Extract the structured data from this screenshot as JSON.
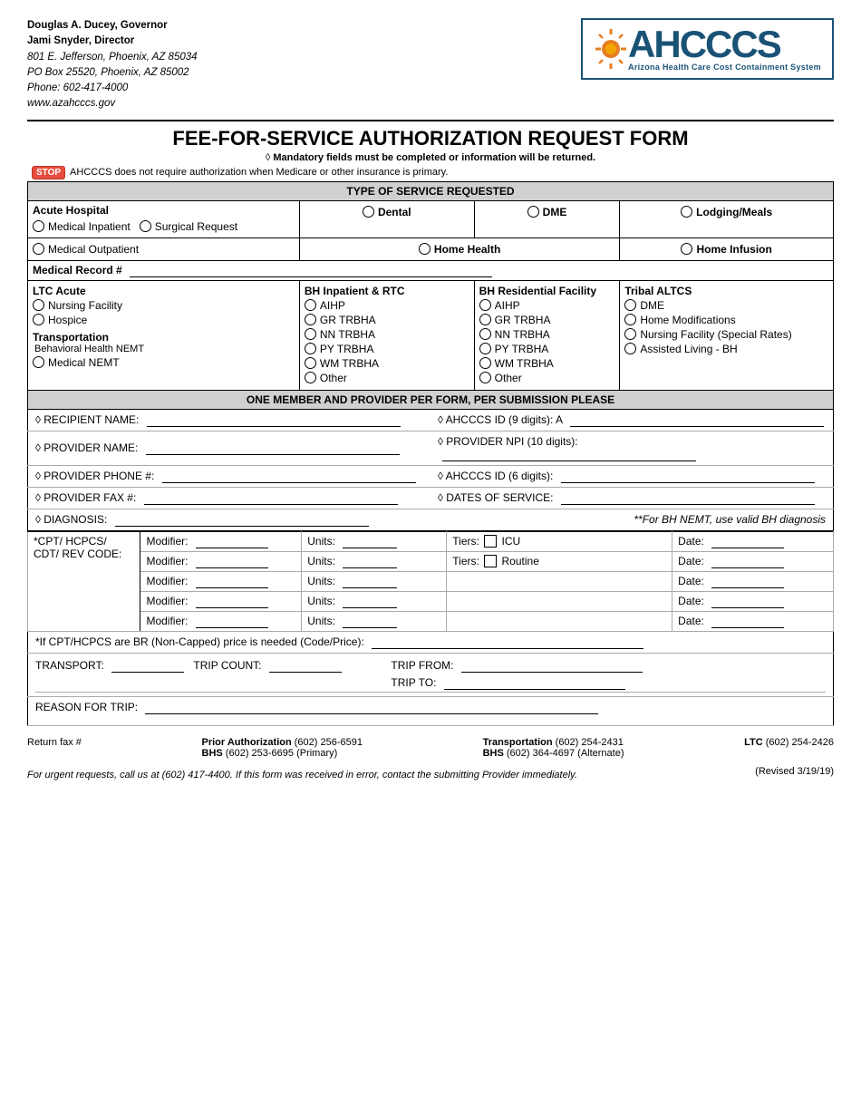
{
  "header": {
    "governor": "Douglas A. Ducey, Governor",
    "director": "Jami Snyder, Director",
    "address1": "801 E. Jefferson, Phoenix, AZ 85034",
    "address2": "PO Box 25520, Phoenix, AZ 85002",
    "phone": "Phone: 602-417-4000",
    "website": "www.azahcccs.gov",
    "org_name": "AHCCCS",
    "org_full": "Arizona Health Care Cost Containment System"
  },
  "form_title": "FEE-FOR-SERVICE AUTHORIZATION REQUEST FORM",
  "mandatory_note": "Mandatory fields must be completed or information will be returned.",
  "stop_note": "AHCCCS does not require authorization when Medicare or other insurance is primary.",
  "type_of_service": "TYPE OF SERVICE REQUESTED",
  "service_types": {
    "acute_hospital": "Acute Hospital",
    "medical_inpatient": "Medical Inpatient",
    "surgical_request": "Surgical Request",
    "dental": "Dental",
    "dme": "DME",
    "lodging_meals": "Lodging/Meals",
    "medical_outpatient": "Medical Outpatient",
    "home_health": "Home Health",
    "home_infusion": "Home Infusion"
  },
  "medical_record": "Medical Record #",
  "ltc_section": {
    "title": "LTC Acute",
    "nursing_facility": "Nursing Facility",
    "hospice": "Hospice",
    "transportation": "Transportation",
    "behavioral_health_nemt": "Behavioral Health NEMT",
    "medical_nemt": "Medical NEMT"
  },
  "bh_inpatient": {
    "title": "BH Inpatient & RTC",
    "aihp": "AIHP",
    "gr_trbha": "GR TRBHA",
    "nn_trbha": "NN TRBHA",
    "py_trbha": "PY TRBHA",
    "wm_trbha": "WM TRBHA",
    "other": "Other"
  },
  "bh_residential": {
    "title": "BH Residential Facility",
    "aihp": "AIHP",
    "gr_trbha": "GR TRBHA",
    "nn_trbha": "NN TRBHA",
    "py_trbha": "PY TRBHA",
    "wm_trbha": "WM TRBHA",
    "other": "Other"
  },
  "tribal_altcs": {
    "title": "Tribal ALTCS",
    "dme": "DME",
    "home_modifications": "Home Modifications",
    "nursing_facility_special": "Nursing Facility (Special Rates)",
    "assisted_living_bh": "Assisted Living - BH"
  },
  "one_member_note": "ONE MEMBER AND PROVIDER PER FORM, PER SUBMISSION PLEASE",
  "fields": {
    "recipient_name_label": "◊ RECIPIENT NAME:",
    "ahcccs_id_label": "◊ AHCCCS ID (9 digits): A",
    "provider_name_label": "◊ PROVIDER NAME:",
    "provider_npi_label": "◊ PROVIDER NPI (10 digits):",
    "provider_phone_label": "◊ PROVIDER PHONE #:",
    "ahcccs_id_6_label": "◊ AHCCCS ID (6 digits):",
    "provider_fax_label": "◊ PROVIDER FAX #:",
    "dates_of_service_label": "◊ DATES OF SERVICE:",
    "diagnosis_label": "◊ DIAGNOSIS:",
    "bh_nemt_note": "**For BH NEMT, use valid BH diagnosis"
  },
  "cpt_section": {
    "code_label": "*CPT/ HCPCS/ CDT/ REV CODE:",
    "modifier_label": "Modifier:",
    "units_label": "Units:",
    "tiers_label": "Tiers:",
    "icu_label": "ICU",
    "routine_label": "Routine",
    "date_label": "Date:",
    "rows": [
      {
        "modifier": "Modifier:",
        "units": "Units:",
        "tiers": true,
        "tier_type": "ICU",
        "date": "Date:"
      },
      {
        "modifier": "Modifier:",
        "units": "Units:",
        "tiers": true,
        "tier_type": "Routine",
        "date": "Date:"
      },
      {
        "modifier": "Modifier:",
        "units": "Units:",
        "tiers": false,
        "tier_type": "",
        "date": "Date:"
      },
      {
        "modifier": "Modifier:",
        "units": "Units:",
        "tiers": false,
        "tier_type": "",
        "date": "Date:"
      },
      {
        "modifier": "Modifier:",
        "units": "Units:",
        "tiers": false,
        "tier_type": "",
        "date": "Date:"
      }
    ]
  },
  "cpt_note": "*If CPT/HCPCS are BR (Non-Capped) price is needed (Code/Price):",
  "transport": {
    "transport_label": "TRANSPORT:",
    "trip_count_label": "TRIP COUNT:",
    "trip_from_label": "TRIP FROM:",
    "trip_to_label": "TRIP TO:",
    "reason_label": "REASON FOR TRIP:"
  },
  "footer": {
    "return_fax": "Return fax #",
    "prior_auth_label": "Prior Authorization",
    "prior_auth_phone": "(602) 256-6591",
    "bhs_primary_label": "BHS",
    "bhs_primary_phone": "(602) 253-6695 (Primary)",
    "transportation_label": "Transportation",
    "transportation_phone": "(602) 254-2431",
    "bhs_alt_label": "BHS",
    "bhs_alt_phone": "(602) 364-4697 (Alternate)",
    "ltc_label": "LTC",
    "ltc_phone": "(602) 254-2426",
    "urgent_note": "For urgent requests, call us at (602) 417-4400.  If this form was received in error, contact the submitting Provider immediately.",
    "revised": "(Revised 3/19/19)"
  }
}
